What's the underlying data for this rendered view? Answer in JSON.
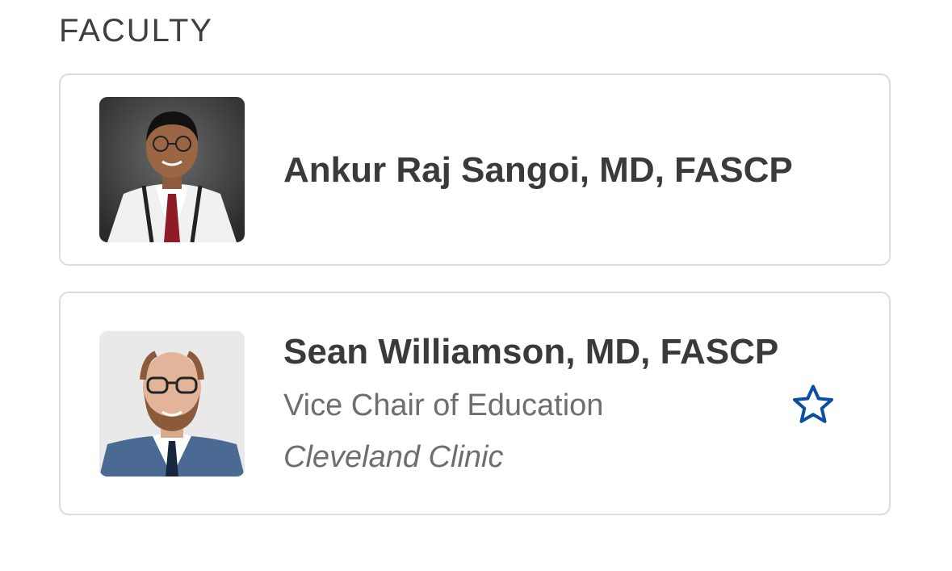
{
  "section": {
    "title": "FACULTY"
  },
  "faculty": [
    {
      "name": "Ankur Raj Sangoi, MD, FASCP"
    },
    {
      "name": "Sean Williamson, MD, FASCP",
      "role": "Vice Chair of Education",
      "organization": "Cleveland Clinic",
      "favorite_icon": "star-outline-icon"
    }
  ],
  "colors": {
    "accent": "#0b4ea2",
    "card_border": "#dcdcdc",
    "title_text": "#3f3f3f",
    "secondary_text": "#6e6e6e"
  }
}
